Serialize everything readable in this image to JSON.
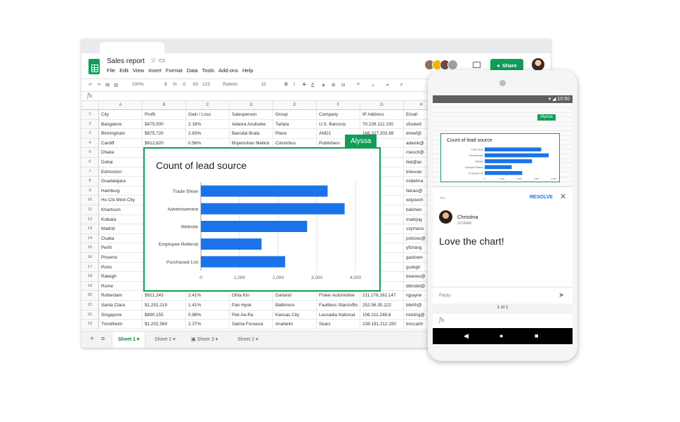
{
  "doc": {
    "title": "Sales report",
    "star_icon": "☆",
    "folder_icon": "▭",
    "menu": [
      "File",
      "Edit",
      "View",
      "Insert",
      "Format",
      "Data",
      "Tools",
      "Add-ons",
      "Help"
    ],
    "share_label": "Share"
  },
  "toolbar": {
    "zoom": "100%",
    "currency": "$",
    "percent": "%",
    "dec1": ".0",
    "dec2": ".00",
    "numfmt": "123",
    "font": "Roboto",
    "size": "11",
    "bold": "B",
    "italic": "I",
    "strike": "S",
    "textcolor": "A"
  },
  "fx": "fx",
  "columns": [
    "A",
    "B",
    "C",
    "D",
    "E",
    "F",
    "G",
    "H"
  ],
  "table": {
    "headers": [
      "City",
      "Profit",
      "Gain / Loss",
      "Salesperson",
      "Group",
      "Company",
      "IP Address",
      "Email"
    ],
    "rows": [
      [
        "Bangalore",
        "$475,000",
        "2.18%",
        "Adaora Azubuike",
        "Tampa",
        "U.S. Bancorp",
        "70.226.112.100",
        "sfoskett"
      ],
      [
        "Birmingham",
        "$975,720",
        "2.83%",
        "Bansilal Brata",
        "Plano",
        "AND1",
        "166.227.202.89",
        "drewf@"
      ],
      [
        "Cardiff",
        "$812,620",
        "0.56%",
        "Brijamohan Mallick",
        "Columbus",
        "Publishers",
        "",
        "adamk@"
      ],
      [
        "Dhaka",
        "",
        "",
        "",
        "",
        "",
        "221.211",
        "roesch@"
      ],
      [
        "Dubai",
        "",
        "",
        "",
        "",
        "",
        "01.145",
        "ilial@ac"
      ],
      [
        "Edmonton",
        "",
        "",
        "",
        "",
        "",
        "52.1",
        "trieuvan"
      ],
      [
        "Guadalajara",
        "",
        "",
        "",
        "",
        "",
        "220.152",
        "mdielma"
      ],
      [
        "Hamburg",
        "",
        "",
        "",
        "",
        "",
        "139.189",
        "falcao@"
      ],
      [
        "Ho Chi Minh City",
        "",
        "",
        "",
        "",
        "",
        "8.134",
        "wojciech"
      ],
      [
        "Khartoum",
        "",
        "",
        "",
        "",
        "",
        "2.219",
        "balchen"
      ],
      [
        "Kolkata",
        "",
        "",
        "",
        "",
        "",
        "123.48",
        "markjug"
      ],
      [
        "Madrid",
        "",
        "",
        "",
        "",
        "",
        "118.233",
        "szymans"
      ],
      [
        "Osaka",
        "",
        "",
        "",
        "",
        "",
        "117.255",
        "policies@"
      ],
      [
        "Perth",
        "",
        "",
        "",
        "",
        "",
        ".237",
        "yfchang"
      ],
      [
        "Phoenix",
        "",
        "",
        "",
        "",
        "",
        "2.205.34",
        "gastown"
      ],
      [
        "Porto",
        "",
        "",
        "",
        "",
        "",
        "194.143",
        "gsokgri"
      ],
      [
        "Raleigh",
        "",
        "",
        "",
        "",
        "",
        "0.37.18",
        "treeves@"
      ],
      [
        "Rome",
        "",
        "",
        "",
        "",
        "",
        "1.86.252",
        "dbindel@"
      ],
      [
        "Rotterdam",
        "$921,243",
        "2.41%",
        "Ohta Kin",
        "Garland",
        "Fisker Automotive",
        "211.176.162.147",
        "njpayne"
      ],
      [
        "Santa Clara",
        "$1,252,219",
        "1.41%",
        "Pan Hyuk",
        "Baltimore",
        "Faultless Starch/Bo",
        "252.56.35.122",
        "bbirth@"
      ],
      [
        "Singapore",
        "$890,155",
        "0.88%",
        "Pek Ae-Ra",
        "Kansas City",
        "Leucadia National",
        "106.211.248.8",
        "nicktrig@"
      ],
      [
        "Trondheim",
        "$1,202,569",
        "2.37%",
        "Salma Fonseca",
        "Anaheim",
        "Sears",
        "238.191.212.150",
        "tmccarth"
      ]
    ]
  },
  "sheets": [
    "Sheet 1",
    "Sheet 2",
    "Sheet 3",
    "Sheet 2"
  ],
  "collaborator_tag": "Alyssa",
  "chart_data": {
    "type": "bar",
    "orientation": "horizontal",
    "title": "Count of lead source",
    "categories": [
      "Trade Show",
      "Advertisement",
      "Website",
      "Employee Referral",
      "Purchased List"
    ],
    "values": [
      3280,
      3720,
      2750,
      1570,
      2180
    ],
    "xlim": [
      0,
      4000
    ],
    "xticks": [
      "0",
      "1,000",
      "2,000",
      "3,000",
      "4,000"
    ],
    "grid": true,
    "bar_color": "#1a73e8"
  },
  "phone": {
    "time": "10:50",
    "resolve_label": "RESOLVE",
    "commenter": "Christina",
    "comment_time": "10:00AM",
    "comment_text": "Love the chart!",
    "reply_placeholder": "Reply",
    "pager": "1 of 1",
    "fx": "fx"
  },
  "colors": {
    "accent": "#0f9d58",
    "bar": "#1a73e8",
    "link": "#1a73e8"
  }
}
